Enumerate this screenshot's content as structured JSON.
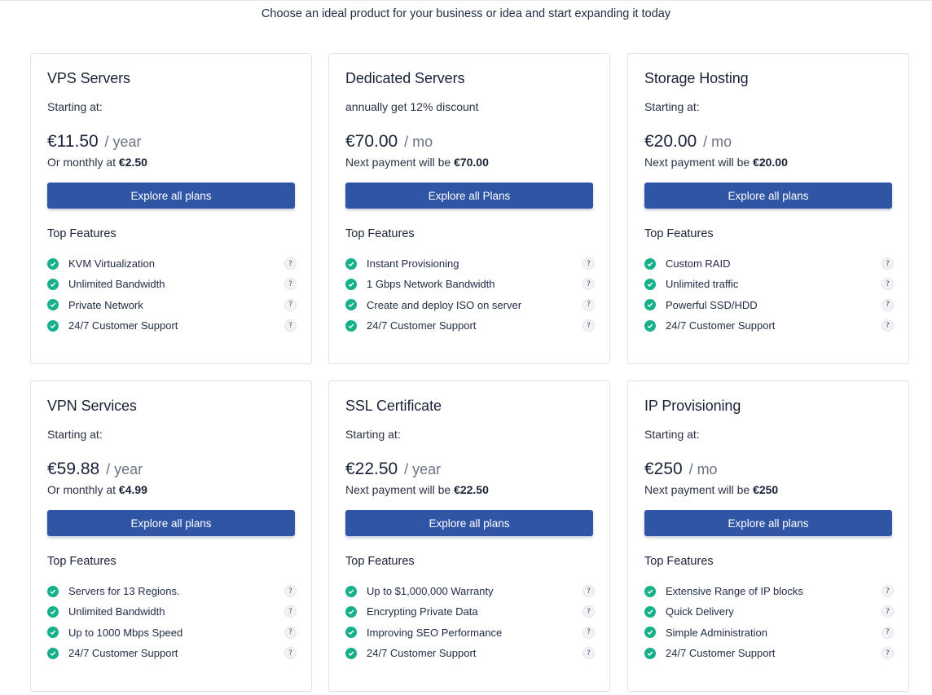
{
  "header": {
    "subtitle": "Choose an ideal product for your business or idea and start expanding it today"
  },
  "feature_heading": "Top Features",
  "icons": {
    "check": "check-circle-icon",
    "help": "question-icon"
  },
  "colors": {
    "button": "#2f55a4",
    "check": "#16b08a"
  },
  "cards": [
    {
      "title": "VPS Servers",
      "subtitle": "Starting at:",
      "price": "€11.50",
      "period": "/ year",
      "note_prefix": "Or monthly at",
      "note_value": "€2.50",
      "button": "Explore all plans",
      "features": [
        "KVM Virtualization",
        "Unlimited Bandwidth",
        "Private Network",
        "24/7 Customer Support"
      ]
    },
    {
      "title": "Dedicated Servers",
      "subtitle": "annually get 12% discount",
      "price": "€70.00",
      "period": "/ mo",
      "note_prefix": "Next payment will be",
      "note_value": "€70.00",
      "button": "Explore all Plans",
      "features": [
        "Instant Provisioning",
        "1 Gbps Network Bandwidth",
        "Create and deploy ISO on server",
        "24/7 Customer Support"
      ]
    },
    {
      "title": "Storage Hosting",
      "subtitle": "Starting at:",
      "price": "€20.00",
      "period": "/ mo",
      "note_prefix": "Next payment will be",
      "note_value": "€20.00",
      "button": "Explore all plans",
      "features": [
        "Custom RAID",
        "Unlimited traffic",
        "Powerful SSD/HDD",
        "24/7 Customer Support"
      ]
    },
    {
      "title": "VPN Services",
      "subtitle": "Starting at:",
      "price": "€59.88",
      "period": "/ year",
      "note_prefix": "Or monthly at",
      "note_value": "€4.99",
      "button": "Explore all plans",
      "features": [
        "Servers for 13 Regions.",
        "Unlimited Bandwidth",
        "Up to 1000 Mbps Speed",
        "24/7 Customer Support"
      ]
    },
    {
      "title": "SSL Certificate",
      "subtitle": "Starting at:",
      "price": "€22.50",
      "period": "/ year",
      "note_prefix": "Next payment will be",
      "note_value": "€22.50",
      "button": "Explore all plans",
      "features": [
        "Up to $1,000,000 Warranty",
        "Encrypting Private Data",
        "Improving SEO Performance",
        "24/7 Customer Support"
      ]
    },
    {
      "title": "IP Provisioning",
      "subtitle": "Starting at:",
      "price": "€250",
      "period": "/ mo",
      "note_prefix": "Next payment will be",
      "note_value": "€250",
      "button": "Explore all plans",
      "features": [
        "Extensive Range of IP blocks",
        "Quick Delivery",
        "Simple Administration",
        "24/7 Customer Support"
      ]
    }
  ]
}
